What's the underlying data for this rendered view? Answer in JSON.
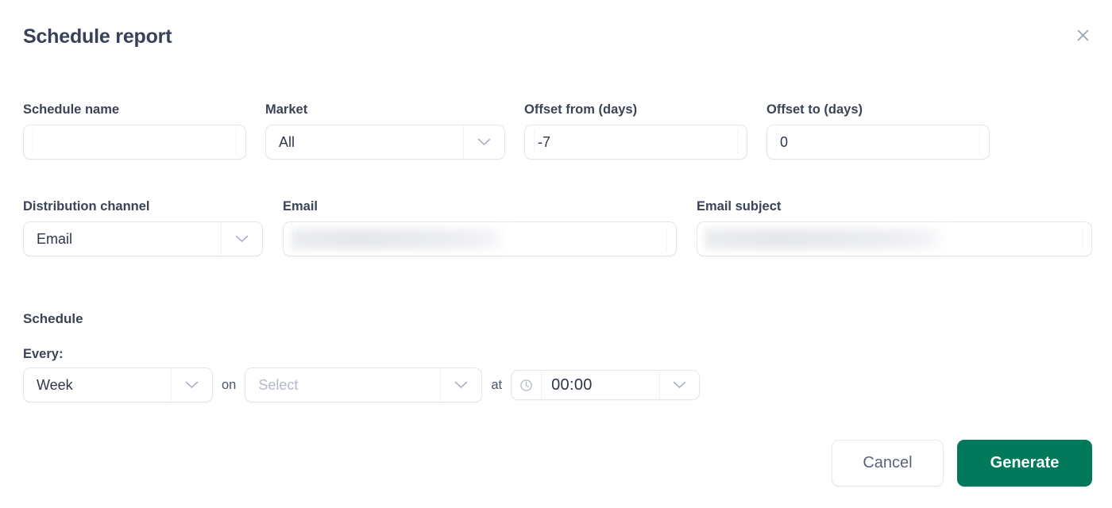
{
  "dialog": {
    "title": "Schedule report",
    "close_icon": "close-icon"
  },
  "fields": {
    "schedule_name": {
      "label": "Schedule name",
      "value": "",
      "placeholder": ""
    },
    "market": {
      "label": "Market",
      "value": "All"
    },
    "offset_from": {
      "label": "Offset from (days)",
      "value": "-7"
    },
    "offset_to": {
      "label": "Offset to (days)",
      "value": "0"
    },
    "distribution_channel": {
      "label": "Distribution channel",
      "value": "Email"
    },
    "email": {
      "label": "Email",
      "value": "",
      "redacted": true
    },
    "email_subject": {
      "label": "Email subject",
      "value": "",
      "redacted": true
    }
  },
  "schedule": {
    "heading": "Schedule",
    "every_label": "Every:",
    "frequency": "Week",
    "on_word": "on",
    "day_placeholder": "Select",
    "at_word": "at",
    "time": "00:00",
    "clock_icon": "clock-icon"
  },
  "footer": {
    "cancel": "Cancel",
    "generate": "Generate"
  },
  "colors": {
    "accent_green": "#02795b",
    "title": "#39415a",
    "label": "#3b4356",
    "border": "#e2e6ee",
    "placeholder": "#b3bac9"
  }
}
